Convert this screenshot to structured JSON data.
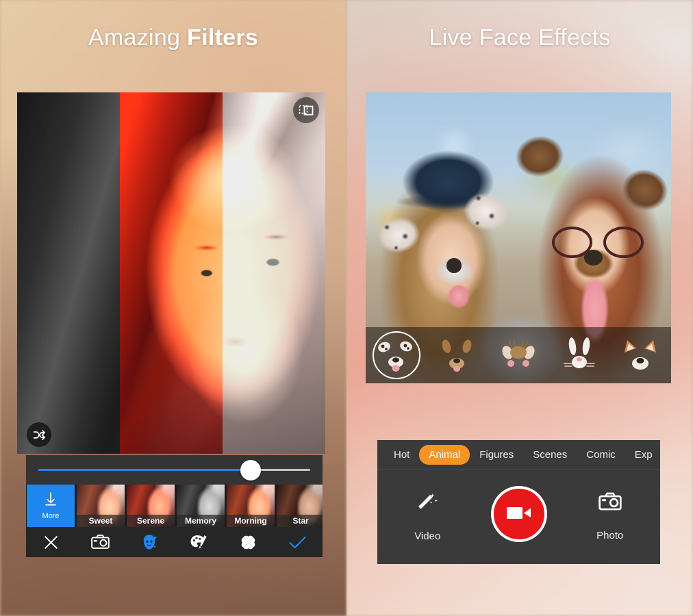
{
  "panels": {
    "left": {
      "title_prefix": "Amazing ",
      "title_bold": "Filters",
      "photo_alt": "portrait-split-filters",
      "compare_icon": "compare-split-icon",
      "shuffle_icon": "shuffle-icon",
      "slider": {
        "name": "filter-intensity-slider",
        "value": 78,
        "min": 0,
        "max": 100,
        "fill_color": "#1f86ee"
      },
      "filters": [
        {
          "label": "More",
          "icon": "download-arrow-icon",
          "kind": "more",
          "active": true
        },
        {
          "label": "Sweet",
          "kind": "thumb"
        },
        {
          "label": "Serene",
          "kind": "thumb"
        },
        {
          "label": "Memory",
          "kind": "thumb"
        },
        {
          "label": "Morning",
          "kind": "thumb"
        },
        {
          "label": "Star",
          "kind": "thumb"
        },
        {
          "label": "",
          "kind": "partial"
        }
      ],
      "toolbar": [
        {
          "icon": "close-icon",
          "label": "Close",
          "active": false
        },
        {
          "icon": "camera-icon",
          "label": "Camera",
          "active": false
        },
        {
          "icon": "beauty-face-icon",
          "label": "Beautify",
          "active": true
        },
        {
          "icon": "palette-brush-icon",
          "label": "Adjust",
          "active": false
        },
        {
          "icon": "effects-icon",
          "label": "Effects",
          "active": false
        },
        {
          "icon": "check-icon",
          "label": "Confirm",
          "active": false
        }
      ]
    },
    "right": {
      "title": "Live Face Effects",
      "photo_alt": "two-women-dog-face-filters",
      "stickers": [
        {
          "name": "dalmatian-sticker",
          "selected": true
        },
        {
          "name": "dog-sticker",
          "selected": false
        },
        {
          "name": "deer-sticker",
          "selected": false
        },
        {
          "name": "bunny-sticker",
          "selected": false
        },
        {
          "name": "fox-sticker",
          "selected": false
        }
      ],
      "tabs": [
        {
          "label": "Hot",
          "active": false
        },
        {
          "label": "Animal",
          "active": true
        },
        {
          "label": "Figures",
          "active": false
        },
        {
          "label": "Scenes",
          "active": false
        },
        {
          "label": "Comic",
          "active": false
        },
        {
          "label": "Exp",
          "active": false,
          "truncated": true
        }
      ],
      "capture": {
        "video_label": "Video",
        "video_icon": "magic-wand-icon",
        "record_icon": "video-camera-icon",
        "record_color": "#e8171a",
        "photo_label": "Photo",
        "photo_icon": "camera-icon"
      }
    }
  },
  "colors": {
    "accent_blue": "#1f86ee",
    "accent_orange": "#f59425",
    "record_red": "#e8171a",
    "panel_dark": "#343434",
    "toolbar_dark": "#262626"
  }
}
